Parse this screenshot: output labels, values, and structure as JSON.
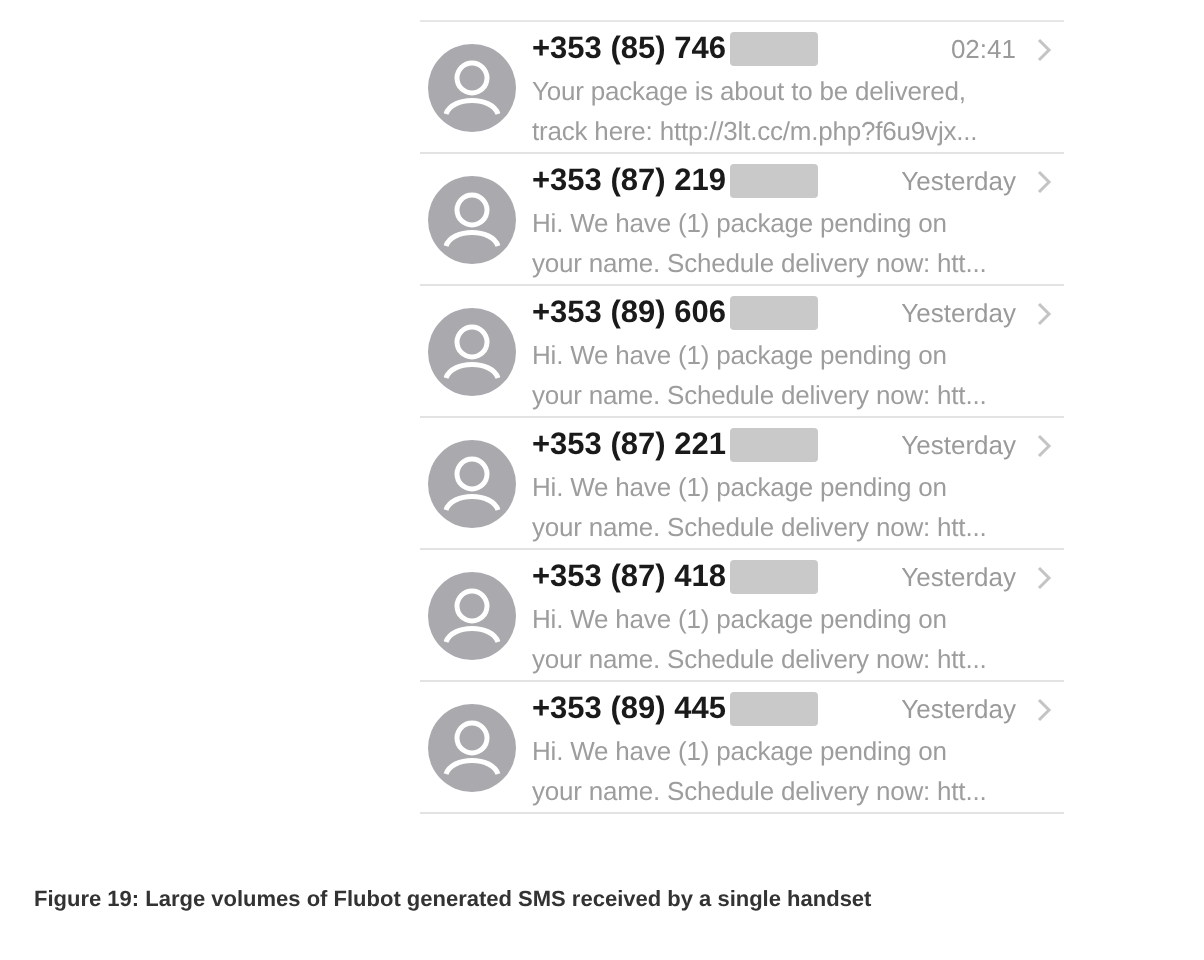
{
  "messages": [
    {
      "sender": "+353 (85) 746",
      "redacted": true,
      "time": "02:41",
      "preview_lines": [
        "Your package is about to be delivered,",
        "track here: http://3lt.cc/m.php?f6u9vjx..."
      ]
    },
    {
      "sender": "+353 (87) 219",
      "redacted": true,
      "time": "Yesterday",
      "preview_lines": [
        "Hi. We have (1) package pending on",
        "your name. Schedule delivery now: htt..."
      ]
    },
    {
      "sender": "+353 (89) 606",
      "redacted": true,
      "time": "Yesterday",
      "preview_lines": [
        "Hi. We have (1) package pending on",
        "your name. Schedule delivery now: htt..."
      ]
    },
    {
      "sender": "+353 (87) 221",
      "redacted": true,
      "time": "Yesterday",
      "preview_lines": [
        "Hi. We have (1) package pending on",
        "your name. Schedule delivery now: htt..."
      ]
    },
    {
      "sender": "+353 (87) 418",
      "redacted": true,
      "time": "Yesterday",
      "preview_lines": [
        "Hi. We have (1) package pending on",
        "your name. Schedule delivery now: htt..."
      ]
    },
    {
      "sender": "+353 (89) 445",
      "redacted": true,
      "time": "Yesterday",
      "preview_lines": [
        "Hi. We have (1) package pending on",
        "your name. Schedule delivery now: htt..."
      ]
    }
  ],
  "caption": "Figure 19: Large volumes of Flubot generated SMS received by a single handset"
}
